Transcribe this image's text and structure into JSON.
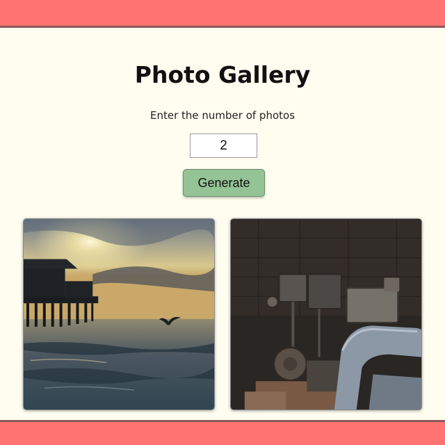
{
  "header": {
    "title": "Photo Gallery"
  },
  "form": {
    "prompt_label": "Enter the number of photos",
    "count_value": "2",
    "generate_label": "Generate"
  },
  "gallery": {
    "photos": [
      {
        "subject": "pier at sunset with seagull over the ocean"
      },
      {
        "subject": "old rusty machinery with a chair in a dark room"
      }
    ]
  },
  "colors": {
    "frame": "#ff7373",
    "background": "#fffdf0",
    "button": "#94c396"
  }
}
